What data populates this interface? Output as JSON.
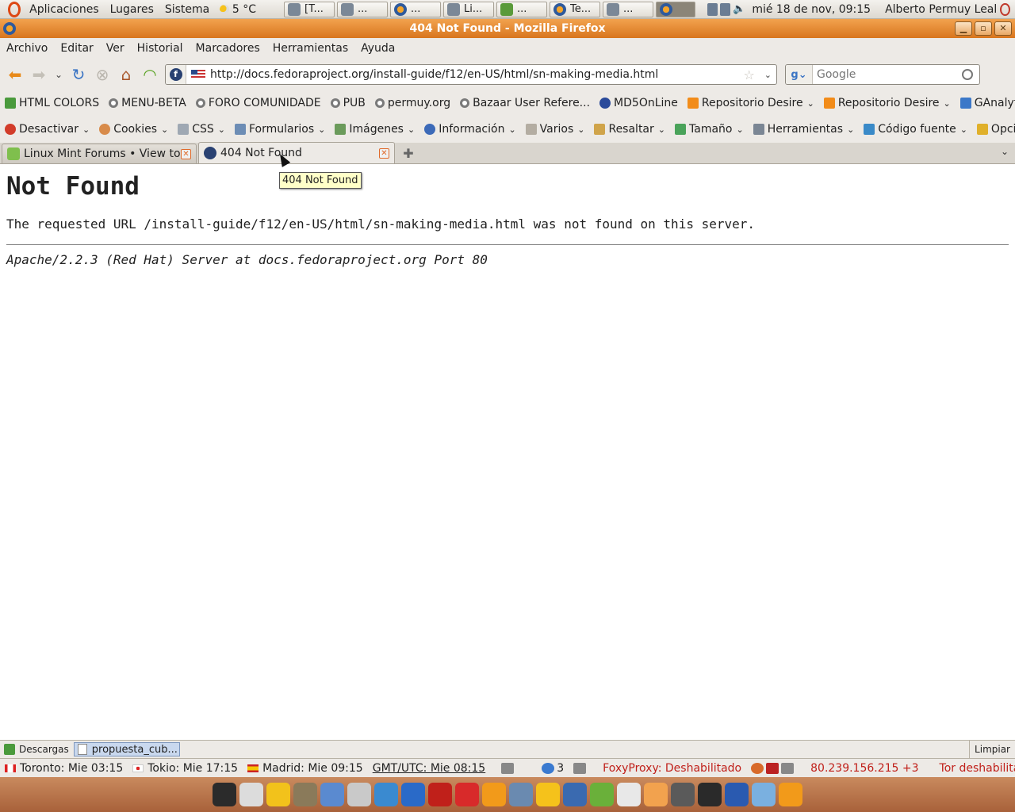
{
  "gnome_top": {
    "menus": [
      "Aplicaciones",
      "Lugares",
      "Sistema"
    ],
    "weather": "5 °C",
    "tasks": [
      {
        "label": "[T...",
        "icon": "terminal-icon",
        "active": false
      },
      {
        "label": "...",
        "icon": "app-icon",
        "active": false
      },
      {
        "label": "...",
        "icon": "firefox-icon",
        "active": false
      },
      {
        "label": "Li...",
        "icon": "network-icon",
        "active": false
      },
      {
        "label": "...",
        "icon": "image-icon",
        "active": false
      },
      {
        "label": "Te...",
        "icon": "firefox-icon",
        "active": false
      },
      {
        "label": "...",
        "icon": "document-icon",
        "active": false
      },
      {
        "label": "",
        "icon": "firefox-icon",
        "active": true
      }
    ],
    "clock": "mié 18 de nov, 09:15",
    "user": "Alberto Permuy Leal"
  },
  "window": {
    "title": "404 Not Found - Mozilla Firefox"
  },
  "menubar": [
    "Archivo",
    "Editar",
    "Ver",
    "Historial",
    "Marcadores",
    "Herramientas",
    "Ayuda"
  ],
  "navbar": {
    "url": "http://docs.fedoraproject.org/install-guide/f12/en-US/html/sn-making-media.html",
    "search_placeholder": "Google"
  },
  "bookmarks": [
    {
      "label": "HTML COLORS",
      "icon": "html",
      "dropdown": false
    },
    {
      "label": "MENU-BETA",
      "icon": "bullet",
      "dropdown": false
    },
    {
      "label": "FORO COMUNIDADE",
      "icon": "bullet",
      "dropdown": false
    },
    {
      "label": "PUB",
      "icon": "bullet",
      "dropdown": false
    },
    {
      "label": "permuy.org",
      "icon": "bullet",
      "dropdown": false
    },
    {
      "label": "Bazaar User Refere...",
      "icon": "bullet",
      "dropdown": false
    },
    {
      "label": "MD5OnLine",
      "icon": "info",
      "dropdown": false
    },
    {
      "label": "Repositorio Desire",
      "icon": "rss",
      "dropdown": true
    },
    {
      "label": "Repositorio Desire",
      "icon": "rss",
      "dropdown": true
    },
    {
      "label": "GAnalytics",
      "icon": "ga",
      "dropdown": false
    }
  ],
  "devbar": [
    {
      "label": "Desactivar",
      "icon": "red"
    },
    {
      "label": "Cookies",
      "icon": "person"
    },
    {
      "label": "CSS",
      "icon": "css"
    },
    {
      "label": "Formularios",
      "icon": "form"
    },
    {
      "label": "Imágenes",
      "icon": "img"
    },
    {
      "label": "Información",
      "icon": "info"
    },
    {
      "label": "Varios",
      "icon": "cube"
    },
    {
      "label": "Resaltar",
      "icon": "pen"
    },
    {
      "label": "Tamaño",
      "icon": "resize"
    },
    {
      "label": "Herramientas",
      "icon": "wrench"
    },
    {
      "label": "Código fuente",
      "icon": "code"
    },
    {
      "label": "Opcio",
      "icon": "key"
    }
  ],
  "tabs": [
    {
      "label": "Linux Mint Forums • View to...",
      "icon": "mint",
      "active": false
    },
    {
      "label": "404 Not Found",
      "icon": "fedora",
      "active": true
    }
  ],
  "tooltip": "404 Not Found",
  "page": {
    "heading": "Not Found",
    "message": "The requested URL /install-guide/f12/en-US/html/sn-making-media.html was not found on this server.",
    "server": "Apache/2.2.3 (Red Hat) Server at docs.fedoraproject.org Port 80"
  },
  "downloads": {
    "label": "Descargas",
    "item": "propuesta_cub...",
    "clear": "Limpiar"
  },
  "statusbar": {
    "clocks": [
      {
        "label": "Toronto: Mie 03:15",
        "flag": "ca"
      },
      {
        "label": "Tokio: Mie 17:15",
        "flag": "jp"
      },
      {
        "label": "Madrid: Mie 09:15",
        "flag": "es"
      }
    ],
    "gmt": "GMT/UTC: Mie 08:15",
    "chat_count": "3",
    "foxyproxy": "FoxyProxy: Deshabilitado",
    "ip": "80.239.156.215 +3",
    "tor": "Tor deshabilitado"
  },
  "dock_colors": [
    "#2b2b2b",
    "#dcdcdc",
    "#f2c21b",
    "#8a7a5a",
    "#5a8ad0",
    "#c9c9c9",
    "#3a8ad0",
    "#2a6ac8",
    "#c0201a",
    "#d82a2a",
    "#f29a1a",
    "#6a8ab0",
    "#f5c21b",
    "#3a6ab0",
    "#6ab03a",
    "#e8e8e8",
    "#f2a24e",
    "#5a5a5a",
    "#2a2a2a",
    "#2a5ab0",
    "#7ab0e0",
    "#f29a1a"
  ]
}
